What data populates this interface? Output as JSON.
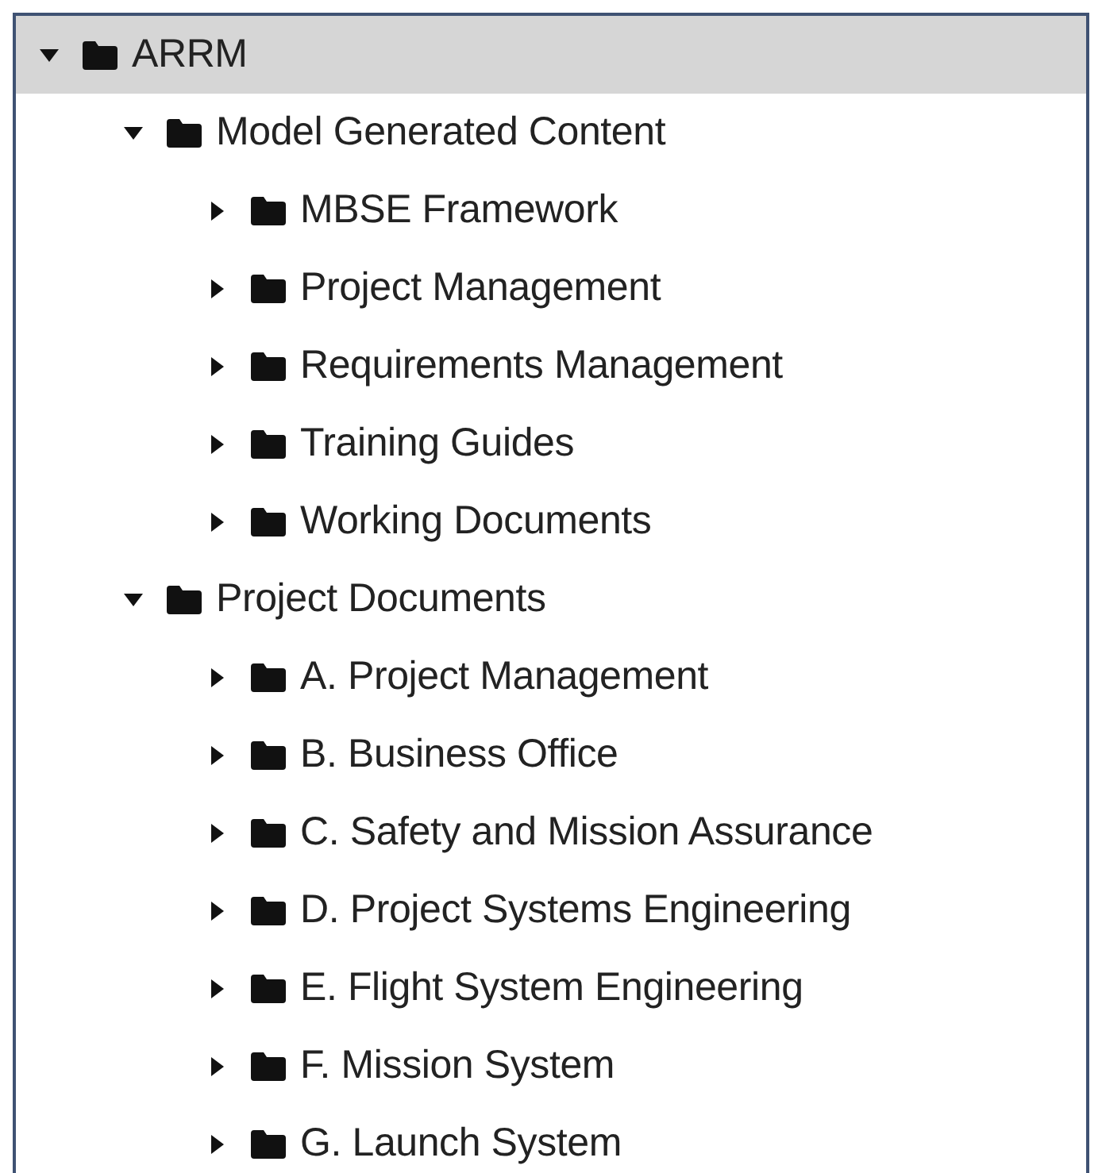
{
  "tree": [
    {
      "label": "ARRM",
      "expanded": true,
      "selected": true,
      "children": [
        {
          "label": "Model Generated Content",
          "expanded": true,
          "selected": false,
          "children": [
            {
              "label": "MBSE Framework",
              "expanded": false,
              "selected": false
            },
            {
              "label": "Project Management",
              "expanded": false,
              "selected": false
            },
            {
              "label": "Requirements Management",
              "expanded": false,
              "selected": false
            },
            {
              "label": "Training Guides",
              "expanded": false,
              "selected": false
            },
            {
              "label": "Working Documents",
              "expanded": false,
              "selected": false
            }
          ]
        },
        {
          "label": "Project Documents",
          "expanded": true,
          "selected": false,
          "children": [
            {
              "label": "A. Project Management",
              "expanded": false,
              "selected": false
            },
            {
              "label": "B. Business Office",
              "expanded": false,
              "selected": false
            },
            {
              "label": "C. Safety and Mission Assurance",
              "expanded": false,
              "selected": false
            },
            {
              "label": "D. Project Systems Engineering",
              "expanded": false,
              "selected": false
            },
            {
              "label": "E. Flight System Engineering",
              "expanded": false,
              "selected": false
            },
            {
              "label": "F. Mission System",
              "expanded": false,
              "selected": false
            },
            {
              "label": "G. Launch System",
              "expanded": false,
              "selected": false
            }
          ]
        }
      ]
    }
  ]
}
